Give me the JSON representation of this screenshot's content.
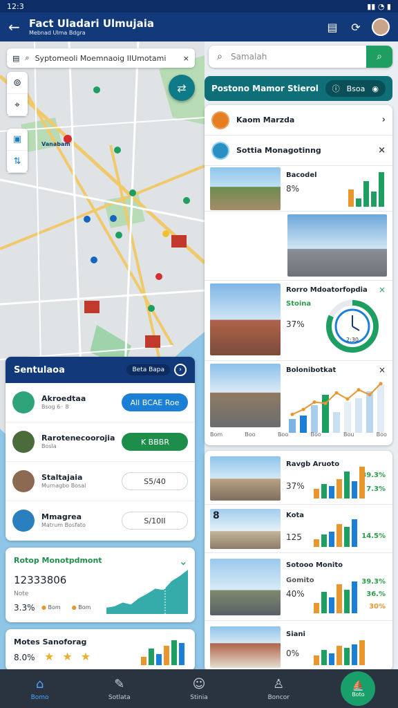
{
  "status": {
    "time": "12:3",
    "signal": "▮▮",
    "wifi": "wifi",
    "battery": "▮"
  },
  "appbar": {
    "title": "Fact Uladari Ulmujaia",
    "subtitle": "Mebnad Ulma Bdgra",
    "back_icon": "arrow-left-icon",
    "clipboard_icon": "clipboard-icon",
    "route_icon": "route-icon"
  },
  "map": {
    "search_text": "Syptomeoli Moemnaoig IIUmotami",
    "close": "×",
    "place_label": "Vanabam"
  },
  "right_search": {
    "placeholder": "Samalah"
  },
  "teal_bar": {
    "label": "Postono Mamor Stierol",
    "pill_text": "Bsoa"
  },
  "right1": {
    "header1": "Kaom Marzda",
    "header2": "Sottia Monagotinng",
    "entries": [
      {
        "title": "Bacodel",
        "pct": "8%",
        "bars": [
          40,
          20,
          60,
          35,
          80
        ],
        "colors": [
          "#e8962e",
          "#1f9e62",
          "#1f9e62",
          "#1f9e62",
          "#1f9e62"
        ]
      },
      {
        "title": "",
        "pct": ""
      },
      {
        "title": "Rorro Mdoatorfopdia",
        "subtitle": "Stoina",
        "pct": "37%",
        "gauge": 0.82,
        "gauge_label": "2:30"
      },
      {
        "title": "Bolonibotkat",
        "axis": [
          "Bom",
          "Boo",
          "Boo",
          "Boo",
          "Bou",
          "Boo"
        ],
        "bars": [
          20,
          25,
          40,
          55,
          30,
          45,
          50,
          60,
          70
        ],
        "line": [
          30,
          38,
          50,
          48,
          65,
          55,
          70,
          62,
          80
        ]
      }
    ]
  },
  "right2": {
    "entries": [
      {
        "title": "Ravgb Aruoto",
        "pct": "37%",
        "val1": "39.3%",
        "val2": "7.3%",
        "bars": [
          20,
          30,
          25,
          40,
          55,
          35,
          65
        ]
      },
      {
        "title": "Kota",
        "big": "8",
        "pct": "125",
        "val1": "14.5%",
        "bars": [
          15,
          25,
          30,
          45,
          40,
          55
        ]
      },
      {
        "title": "Sotooo Monito",
        "sub": "Gomito",
        "pct": "40%",
        "val1": "39.3%",
        "val2": "36.%",
        "val3": "30%",
        "bars": [
          20,
          40,
          30,
          55,
          45,
          60
        ]
      },
      {
        "title": "Siani",
        "pct": "0%",
        "bars": [
          25,
          40,
          30,
          50,
          45,
          55,
          65
        ]
      }
    ]
  },
  "left1": {
    "header": "Sentulaoa",
    "header_pill": "Beta Bapa",
    "rows": [
      {
        "title": "Akroedtaa",
        "sub": "Bsog   6◦ 8",
        "btn": "All BCAE Roe",
        "btn_style": "blue",
        "icon_color": "#2fa37a"
      },
      {
        "title": "Rarotenecoorojia",
        "sub": "Bosla",
        "btn": "K BBBR",
        "btn_style": "green",
        "icon_color": "#4a6b3a"
      },
      {
        "title": "Staltajaia",
        "sub": "Murnagbo Bosal",
        "btn": "S5/40",
        "btn_style": "out",
        "icon_color": "#8c6a52"
      },
      {
        "title": "Mmagrea",
        "sub": "Matrum Bosfato",
        "btn": "S/10II",
        "btn_style": "out",
        "icon_color": "#2a7fbf"
      }
    ]
  },
  "left2": {
    "title": "Rotop Monotpdmont",
    "big": "12333806",
    "sub": "Note",
    "pct": "3.3%",
    "legend1": "Bom",
    "legend2": "Bom",
    "points": [
      10,
      12,
      18,
      15,
      25,
      32,
      40,
      38,
      52,
      60,
      70
    ]
  },
  "left3": {
    "title": "Motes Sanoforag",
    "pct": "8.0%",
    "stars": [
      "★",
      "★",
      "★"
    ],
    "bars": [
      15,
      30,
      20,
      35,
      45,
      40
    ]
  },
  "nav": [
    {
      "label": "Bomo",
      "icon": "⌂",
      "active": true
    },
    {
      "label": "Sotlata",
      "icon": "✎",
      "active": false
    },
    {
      "label": "Stinia",
      "icon": "☺",
      "active": false
    },
    {
      "label": "Boncor",
      "icon": "♙",
      "active": false
    },
    {
      "label": "Boto",
      "icon": "⛵",
      "fab": true
    }
  ],
  "colors": {
    "navy": "#123a7a",
    "teal": "#0f6f78",
    "green": "#1f9e62",
    "blue": "#1c7fd6",
    "orange": "#e8962e"
  }
}
